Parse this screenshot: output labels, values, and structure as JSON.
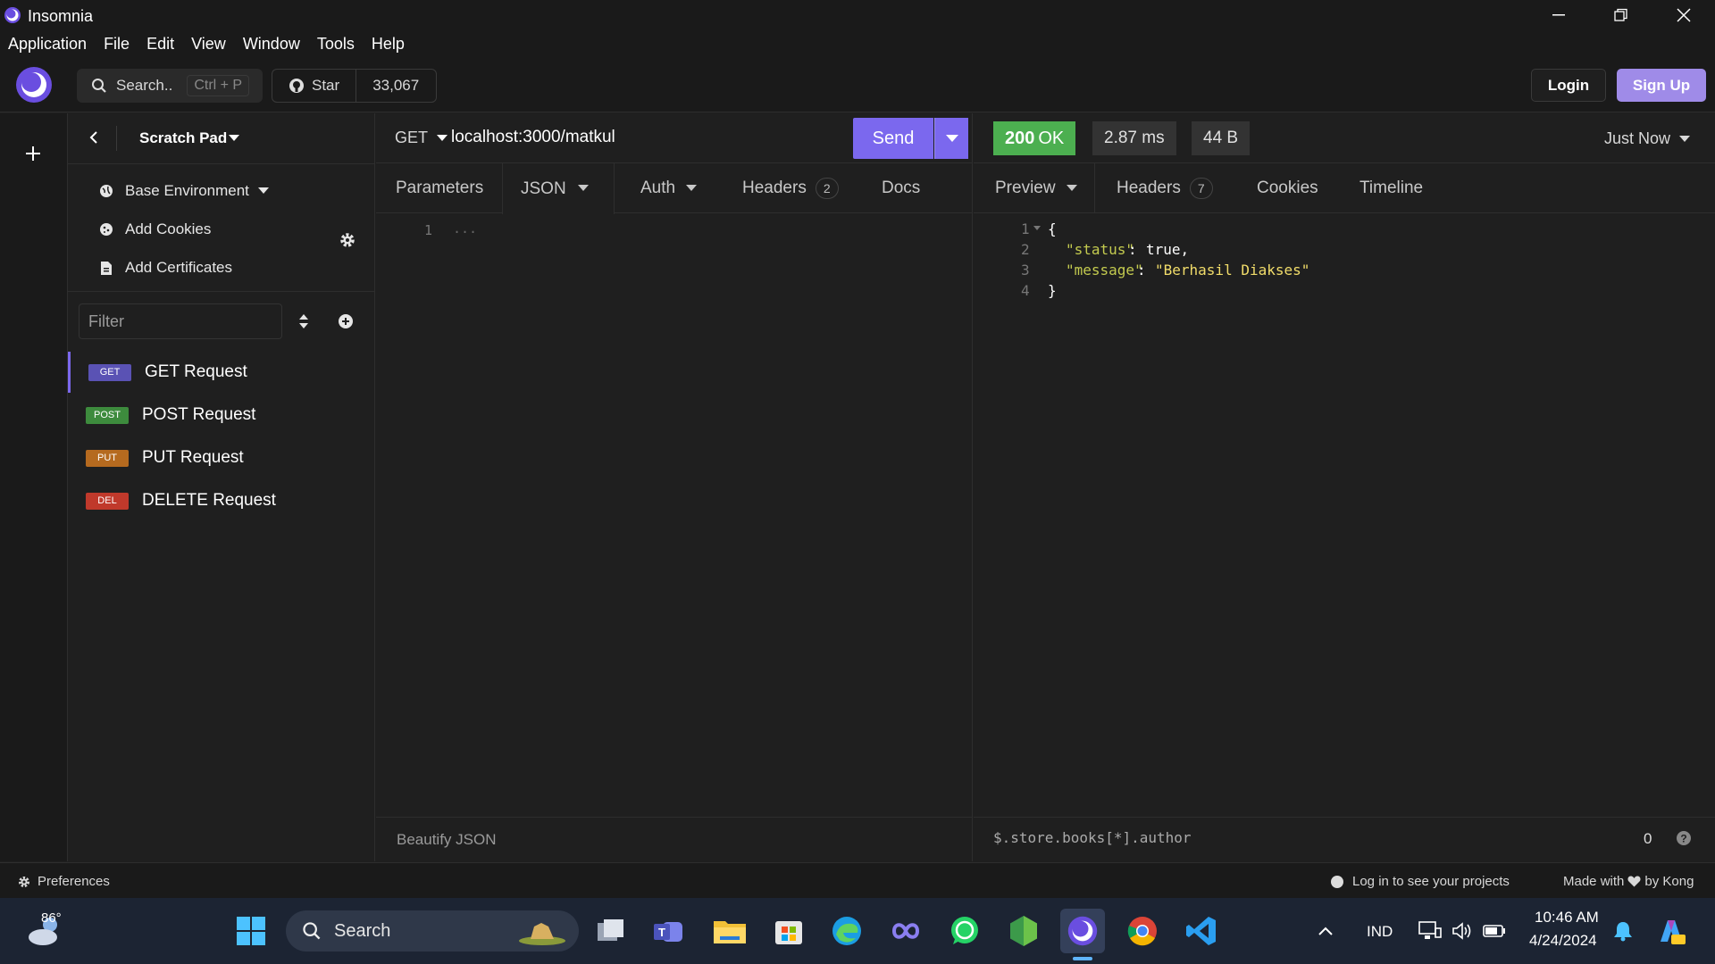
{
  "window": {
    "title": "Insomnia"
  },
  "menu": [
    "Application",
    "File",
    "Edit",
    "View",
    "Window",
    "Tools",
    "Help"
  ],
  "header": {
    "search_label": "Search..",
    "search_shortcut": "Ctrl + P",
    "star_label": "Star",
    "star_count": "33,067",
    "login_label": "Login",
    "signup_label": "Sign Up"
  },
  "sidebar": {
    "scratch_title": "Scratch Pad",
    "env_items": [
      {
        "label": "Base Environment",
        "icon": "globe-icon"
      },
      {
        "label": "Add Cookies",
        "icon": "cookie-icon"
      },
      {
        "label": "Add Certificates",
        "icon": "certificate-icon"
      }
    ],
    "filter_placeholder": "Filter",
    "requests": [
      {
        "method": "GET",
        "label": "GET Request",
        "color": "#5a52b4"
      },
      {
        "method": "POST",
        "label": "POST Request",
        "color": "#3d8b3d"
      },
      {
        "method": "PUT",
        "label": "PUT Request",
        "color": "#b56a1f"
      },
      {
        "method": "DEL",
        "label": "DELETE Request",
        "color": "#c0392b"
      }
    ]
  },
  "request": {
    "method": "GET",
    "url": "localhost:3000/matkul",
    "send_label": "Send",
    "tabs": {
      "params": "Parameters",
      "body": "JSON",
      "auth": "Auth",
      "headers": "Headers",
      "headers_count": "2",
      "docs": "Docs"
    },
    "editor": {
      "line": "1",
      "content": "..."
    },
    "footer": "Beautify JSON"
  },
  "response": {
    "status_code": "200",
    "status_text": "OK",
    "time": "2.87 ms",
    "size": "44 B",
    "time_label": "Just Now",
    "tabs": {
      "preview": "Preview",
      "headers": "Headers",
      "headers_count": "7",
      "cookies": "Cookies",
      "timeline": "Timeline"
    },
    "body": {
      "ln1": "1",
      "ln2": "2",
      "ln3": "3",
      "ln4": "4",
      "open": "{",
      "key1": "\"status\"",
      "val1": "true,",
      "key2": "\"message\"",
      "val2": "\"Berhasil Diakses\"",
      "close": "}"
    },
    "filter_query": "$.store.books[*].author",
    "filter_count": "0"
  },
  "statusbar": {
    "preferences": "Preferences",
    "login_msg": "Log in to see your projects",
    "made_with": "Made with",
    "by": "by Kong"
  },
  "taskbar": {
    "weather": "86°",
    "search": "Search",
    "lang": "IND",
    "time": "10:46 AM",
    "date": "4/24/2024"
  }
}
